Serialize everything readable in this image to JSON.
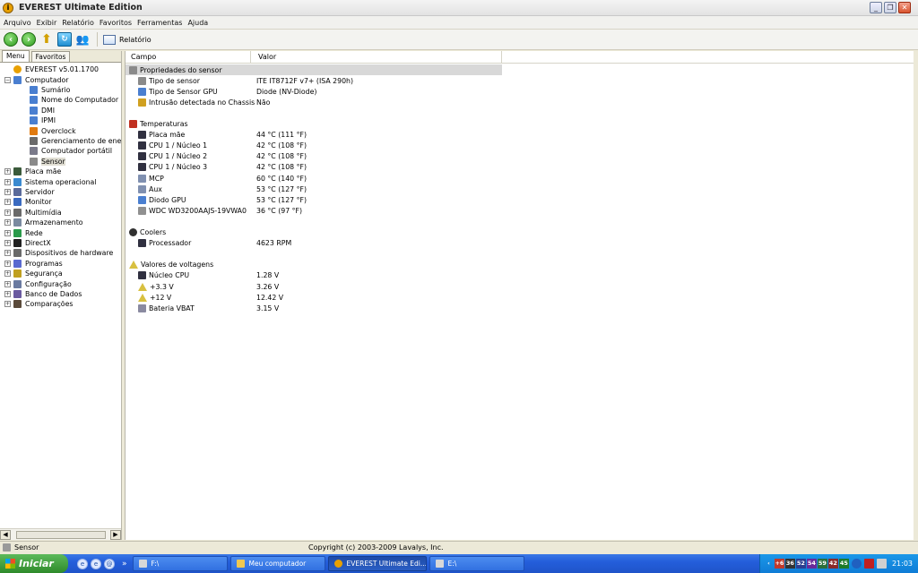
{
  "window": {
    "title": "EVEREST Ultimate Edition",
    "icon": "everest-icon"
  },
  "menu": [
    "Arquivo",
    "Exibir",
    "Relatório",
    "Favoritos",
    "Ferramentas",
    "Ajuda"
  ],
  "toolbar": {
    "report_label": "Relatório"
  },
  "left_tabs": [
    "Menu",
    "Favoritos"
  ],
  "tree": [
    {
      "label": "EVEREST v5.01.1700",
      "icon": "everest-icon",
      "level": 0,
      "expander": ""
    },
    {
      "label": "Computador",
      "icon": "computer-icon",
      "level": 0,
      "expander": "−"
    },
    {
      "label": "Sumário",
      "icon": "computer-icon",
      "level": 1,
      "expander": ""
    },
    {
      "label": "Nome do Computador",
      "icon": "computer-icon",
      "level": 1,
      "expander": ""
    },
    {
      "label": "DMI",
      "icon": "computer-icon",
      "level": 1,
      "expander": ""
    },
    {
      "label": "IPMI",
      "icon": "computer-icon",
      "level": 1,
      "expander": ""
    },
    {
      "label": "Overclock",
      "icon": "flame-icon",
      "level": 1,
      "expander": ""
    },
    {
      "label": "Gerenciamento de energi",
      "icon": "power-icon",
      "level": 1,
      "expander": ""
    },
    {
      "label": "Computador portátil",
      "icon": "laptop-icon",
      "level": 1,
      "expander": ""
    },
    {
      "label": "Sensor",
      "icon": "sensor-icon",
      "level": 1,
      "expander": "",
      "selected": true
    },
    {
      "label": "Placa mãe",
      "icon": "motherboard-icon",
      "level": 0,
      "expander": "+"
    },
    {
      "label": "Sistema operacional",
      "icon": "windows-icon",
      "level": 0,
      "expander": "+"
    },
    {
      "label": "Servidor",
      "icon": "server-icon",
      "level": 0,
      "expander": "+"
    },
    {
      "label": "Monitor",
      "icon": "monitor-icon",
      "level": 0,
      "expander": "+"
    },
    {
      "label": "Multimídia",
      "icon": "multimedia-icon",
      "level": 0,
      "expander": "+"
    },
    {
      "label": "Armazenamento",
      "icon": "storage-icon",
      "level": 0,
      "expander": "+"
    },
    {
      "label": "Rede",
      "icon": "network-icon",
      "level": 0,
      "expander": "+"
    },
    {
      "label": "DirectX",
      "icon": "directx-icon",
      "level": 0,
      "expander": "+"
    },
    {
      "label": "Dispositivos de hardware",
      "icon": "hardware-icon",
      "level": 0,
      "expander": "+"
    },
    {
      "label": "Programas",
      "icon": "programs-icon",
      "level": 0,
      "expander": "+"
    },
    {
      "label": "Segurança",
      "icon": "security-icon",
      "level": 0,
      "expander": "+"
    },
    {
      "label": "Configuração",
      "icon": "config-icon",
      "level": 0,
      "expander": "+"
    },
    {
      "label": "Banco de Dados",
      "icon": "database-icon",
      "level": 0,
      "expander": "+"
    },
    {
      "label": "Comparações",
      "icon": "benchmark-icon",
      "level": 0,
      "expander": "+"
    }
  ],
  "columns": {
    "field": "Campo",
    "value": "Valor"
  },
  "rows": [
    {
      "type": "header",
      "field": "Propriedades do sensor",
      "icon": "sensor-icon"
    },
    {
      "type": "item",
      "field": "Tipo de sensor",
      "value": "ITE IT8712F v7+  (ISA 290h)",
      "icon": "sensor-icon"
    },
    {
      "type": "item",
      "field": "Tipo de Sensor GPU",
      "value": "Diode  (NV-Diode)",
      "icon": "computer-icon"
    },
    {
      "type": "item",
      "field": "Intrusão detectada no Chassis",
      "value": "Não",
      "icon": "lock-icon"
    },
    {
      "type": "blank"
    },
    {
      "type": "section",
      "field": "Temperaturas",
      "icon": "thermometer-icon"
    },
    {
      "type": "item",
      "field": "Placa mãe",
      "value": "44 °C  (111 °F)",
      "icon": "chip-icon"
    },
    {
      "type": "item",
      "field": "CPU 1 / Núcleo 1",
      "value": "42 °C  (108 °F)",
      "icon": "chip-icon"
    },
    {
      "type": "item",
      "field": "CPU 1 / Núcleo 2",
      "value": "42 °C  (108 °F)",
      "icon": "chip-icon"
    },
    {
      "type": "item",
      "field": "CPU 1 / Núcleo 3",
      "value": "42 °C  (108 °F)",
      "icon": "chip-icon"
    },
    {
      "type": "item",
      "field": "MCP",
      "value": "60 °C  (140 °F)",
      "icon": "disk-icon"
    },
    {
      "type": "item",
      "field": "Aux",
      "value": "53 °C  (127 °F)",
      "icon": "disk-icon"
    },
    {
      "type": "item",
      "field": "Diodo GPU",
      "value": "53 °C  (127 °F)",
      "icon": "computer-icon"
    },
    {
      "type": "item",
      "field": "WDC WD3200AAJS-19VWA0",
      "value": "36 °C  (97 °F)",
      "icon": "harddrive-icon"
    },
    {
      "type": "blank"
    },
    {
      "type": "section",
      "field": "Coolers",
      "icon": "fan-icon"
    },
    {
      "type": "item",
      "field": "Processador",
      "value": "4623 RPM",
      "icon": "chip-icon"
    },
    {
      "type": "blank"
    },
    {
      "type": "section",
      "field": "Valores de voltagens",
      "icon": "warning-icon"
    },
    {
      "type": "item",
      "field": "Núcleo CPU",
      "value": "1.28 V",
      "icon": "chip-icon"
    },
    {
      "type": "item",
      "field": "+3.3 V",
      "value": "3.26 V",
      "icon": "warning-icon"
    },
    {
      "type": "item",
      "field": "+12 V",
      "value": "12.42 V",
      "icon": "warning-icon"
    },
    {
      "type": "item",
      "field": "Bateria VBAT",
      "value": "3.15 V",
      "icon": "battery-icon"
    }
  ],
  "status": {
    "left": "Sensor",
    "copyright": "Copyright (c) 2003-2009 Lavalys, Inc."
  },
  "taskbar": {
    "start": "Iniciar",
    "tasks": [
      {
        "label": "F:\\",
        "icon": "drive-icon"
      },
      {
        "label": "Meu computador",
        "icon": "folder-icon"
      },
      {
        "label": "EVEREST Ultimate Edi...",
        "icon": "everest-icon",
        "active": true
      },
      {
        "label": "E:\\",
        "icon": "drive-icon"
      }
    ],
    "tray_values": [
      "+6",
      "36",
      "52",
      "54",
      "59",
      "42",
      "45"
    ],
    "tray_colors": [
      "#c0392b",
      "#333333",
      "#2c3e90",
      "#6a2a9a",
      "#2c6e3a",
      "#8a2a2a",
      "#1e7a2a"
    ],
    "clock": "21:03"
  }
}
